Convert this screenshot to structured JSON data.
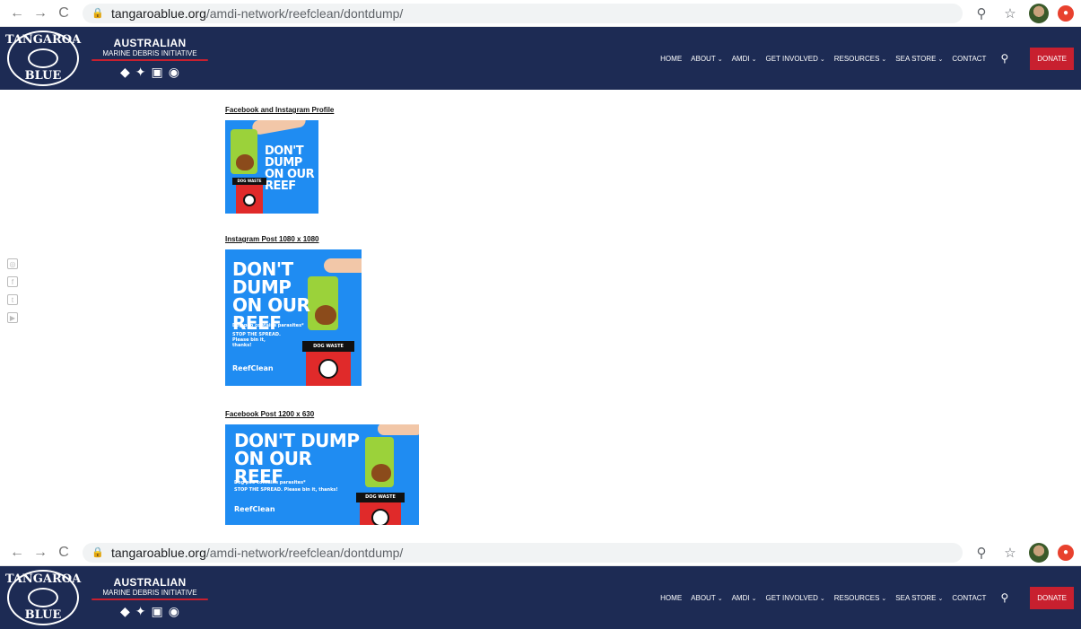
{
  "browser": {
    "back": "←",
    "forward": "→",
    "reload": "C",
    "url_domain": "tangaroablue.org",
    "url_path": "/amdi-network/reefclean/dontdump/"
  },
  "header": {
    "logo_top": "TANGAROA",
    "logo_bottom": "BLUE",
    "amdi_title": "AUSTRALIAN",
    "amdi_subtitle": "MARINE DEBRIS INITIATIVE",
    "nav": [
      {
        "label": "HOME",
        "has_dropdown": false
      },
      {
        "label": "ABOUT",
        "has_dropdown": true
      },
      {
        "label": "AMDI",
        "has_dropdown": true
      },
      {
        "label": "GET INVOLVED",
        "has_dropdown": true
      },
      {
        "label": "RESOURCES",
        "has_dropdown": true
      },
      {
        "label": "SEA STORE",
        "has_dropdown": true
      },
      {
        "label": "CONTACT",
        "has_dropdown": false
      }
    ],
    "donate": "DONATE"
  },
  "social": [
    "instagram-icon",
    "facebook-icon",
    "twitter-icon",
    "youtube-icon"
  ],
  "sections": [
    {
      "title": "Facebook and Instagram Profile",
      "image": {
        "headline": "DON'T DUMP ON OUR REEF",
        "bin_label": "DOG WASTE"
      }
    },
    {
      "title": "Instagram Post 1080 x 1080",
      "image": {
        "headline": "DON'T DUMP ON OUR REEF",
        "line1": "Dog poo contains parasites*",
        "line2": "STOP THE SPREAD. Please bin it, thanks!",
        "bin_label": "DOG WASTE",
        "brand": "ReefClean"
      }
    },
    {
      "title": "Facebook Post 1200 x 630",
      "image": {
        "headline": "DON'T DUMP ON OUR REEF",
        "line1": "Dog poo contains parasites*",
        "line2": "STOP THE SPREAD. Please bin it, thanks!",
        "bin_label": "DOG WASTE",
        "brand": "ReefClean"
      }
    }
  ],
  "colors": {
    "header_bg": "#1d2b54",
    "donate_bg": "#c8202f",
    "tile_bg": "#1f8cf2"
  }
}
